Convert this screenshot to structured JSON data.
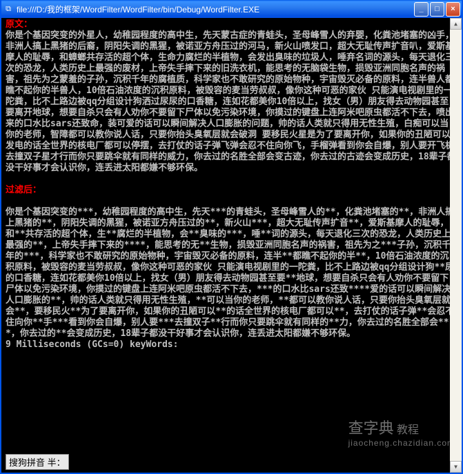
{
  "titlebar": {
    "icon": "⧉",
    "path": "file:///D:/我的框架/WordFilter/WordFilter/bin/Debug/WordFilter.EXE"
  },
  "win_buttons": {
    "min": "_",
    "max": "□",
    "close": "×"
  },
  "heading_original": "原文：",
  "original_text": "你是个基因突变的外星人，幼稚园程度的高中生，先天蒙古症的青蛙头，圣母峰雪人的弃婴，化粪池堵塞的凶手，非洲人搞上黑猪的后裔，阴阳失调的黑猩，被诺亚方舟压过的河马，新火山喷发口，超大无耻传声扩音叭，爱斯基摩人的耻辱，和蟑螂共存活的超个体，生命力腐烂的半植物，会发出臭味的垃圾人，唾弃名词的源头，每天退化三次的恐龙，人类历史上最强的废材，上帝失手摔下来的旧洗衣机，能思考的无脑袋生物，损毁亚洲同胞名声的祸害，祖先为之蒙羞的子孙，沉积千年的腐植质，科学家也不敢研究的原始物种，宇宙毁灭必备的原料，连半兽人都瞧不起你的半兽人，10倍石油浓度的沉积原料，被毁容的麦当劳叔叔，像你这种可恶的家伙 只能演电视剧里的一陀粪，比不上路边被qq分组设计狗洒过尿尿的口香糖，连如花都美你10倍以上，找女（男）朋友得去动物园甚至要离开地球，想要自杀只会有人劝你不要留下尸体以免污染环境，你摸过的键盘上连阿米吧原虫都活不下去，喷出来的口水比sars还致命，装可爱的话可以瞬间解决人口膨胀的问题，帅的话人类就只得用无性生殖，白痴可以当你的老师，智障都可以教你说人话，只要你抬头臭氧层就会破洞 要移民火星是为了要离开你，如果你的丑陋可以发电的话全世界的核电厂都可以停摆，去打仗的话子弹飞弹会忍不住向你飞，手榴弹看到你会自爆，别人要开飞机去撞双子星才行而你只要跳伞就有同样的威力，你去过的名胜全部会变古迹，你去过的古迹会变成历史，18辈子都没干好事才会认识你，连丢进太阳都嫌不够环保。",
  "heading_filtered": "过滤后：",
  "filtered_text": "你是个基因突变的***，幼稚园程度的高中生，先天***的青蛙头，圣母峰雪人的**，化粪池堵塞的**，非洲人搞上黑猪的**，阴阳失调的黑猩，被诺亚方舟压过的**，新火山***，超大无耻传声扩音**，爱斯基摩人的耻辱，和**共存活的超个体，生**腐烂的半植物，会**臭味的***，唾**词的源头，每天退化三次的恐龙，人类历史上最强的**，上帝失手摔下来的****，能思考的无**生物，损毁亚洲同胞名声的祸害，祖先为之***子孙，沉积千年的***，科学家也不敢研究的原始物种，宇宙毁灭必备的原料，连半**都瞧不起你的半**，10倍石油浓度的沉积原料，被毁容的麦当劳叔叔，像你这种可恶的家伙 只能演电视剧里的一陀粪，比不上路边被qq分组设计狗**尿的口香糖，连如花都美你10倍以上，找女（男）朋友得去动物园甚至要**地球，想要自杀只会有人劝你不要留下尸体以免污染环境，你摸过的键盘上连阿米吧原虫都活不下去，***的口水比sars还致****爱的话可以瞬间解决人口膨胀的**，帅的话人类就只得用无性生殖，**可以当你的老师，**都可以教你说人话，只要你抬头臭氧层就会**，要移民火**为了要离开你，如果你的丑陋可以**的话全世界的核电厂都可以**，去打仗的话子弹**会忍不住向你**手***看到你会自爆，别人要***去撞双子**行而你只要跳伞就有同样的**力，你去过的名胜全部会***，你去过的**会变成历史，18辈子都没干好事才会认识你，连丢进太阳都嫌不够环保。",
  "timing_line": "9 Milliseconds (GCs=0) keyWords:",
  "ime": {
    "label": "搜狗拼音 半："
  },
  "watermark": {
    "main": "查字典",
    "sub": "jiaocheng.chazidian.com"
  },
  "scrollbar": {
    "up": "▲",
    "down": "▼"
  }
}
